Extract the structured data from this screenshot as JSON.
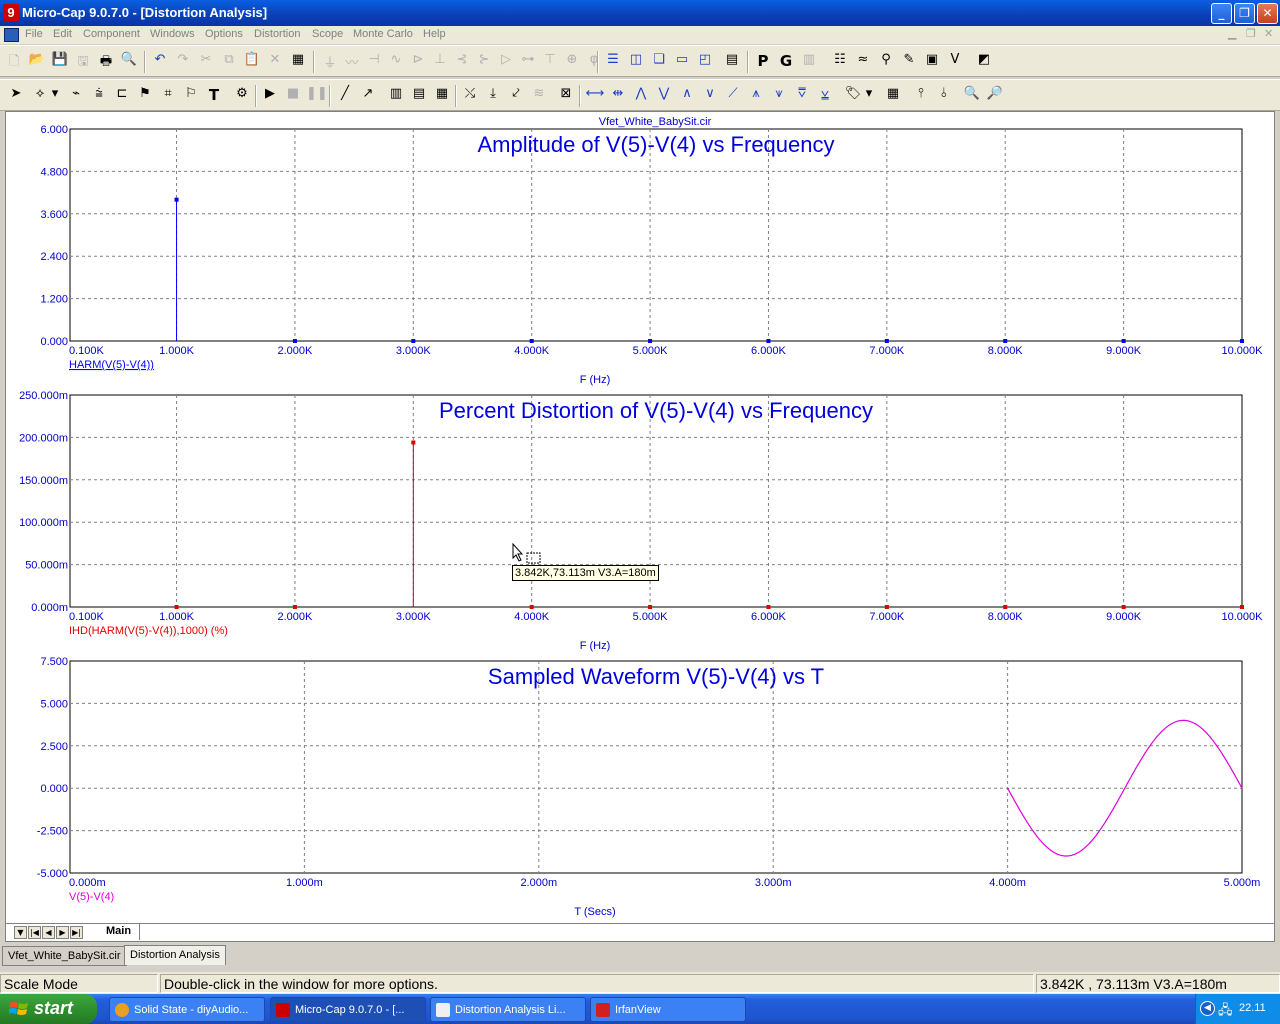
{
  "window": {
    "title": "Micro-Cap 9.0.7.0 - [Distortion Analysis]",
    "app_icon": "9"
  },
  "menu": [
    "File",
    "Edit",
    "Component",
    "Windows",
    "Options",
    "Distortion",
    "Scope",
    "Monte Carlo",
    "Help"
  ],
  "plot": {
    "circuit_name": "Vfet_White_BabySit.cir",
    "panels": [
      {
        "title": "Amplitude of V(5)-V(4) vs Frequency",
        "y_ticks": [
          "6.000",
          "4.800",
          "3.600",
          "2.400",
          "1.200",
          "0.000"
        ],
        "x_ticks": [
          "0.100K",
          "1.000K",
          "2.000K",
          "3.000K",
          "4.000K",
          "5.000K",
          "6.000K",
          "7.000K",
          "8.000K",
          "9.000K",
          "10.000K"
        ],
        "trace_label": "HARM(V(5)-V(4))",
        "xlabel": "F (Hz)",
        "color": "#0000ff"
      },
      {
        "title": "Percent Distortion of V(5)-V(4) vs Frequency",
        "y_ticks": [
          "250.000m",
          "200.000m",
          "150.000m",
          "100.000m",
          "50.000m",
          "0.000m"
        ],
        "x_ticks": [
          "0.100K",
          "1.000K",
          "2.000K",
          "3.000K",
          "4.000K",
          "5.000K",
          "6.000K",
          "7.000K",
          "8.000K",
          "9.000K",
          "10.000K"
        ],
        "trace_label": "IHD(HARM(V(5)-V(4)),1000) (%)",
        "xlabel": "F (Hz)",
        "color": "#e00000"
      },
      {
        "title": "Sampled Waveform  V(5)-V(4) vs T",
        "y_ticks": [
          "7.500",
          "5.000",
          "2.500",
          "0.000",
          "-2.500",
          "-5.000"
        ],
        "x_ticks": [
          "0.000m",
          "1.000m",
          "2.000m",
          "3.000m",
          "4.000m",
          "5.000m"
        ],
        "trace_label": "V(5)-V(4)",
        "xlabel": "T (Secs)",
        "color": "#e000e0"
      }
    ],
    "tooltip": "3.842K,73.113m V3.A=180m"
  },
  "chart_data": [
    {
      "type": "bar",
      "title": "Amplitude of V(5)-V(4) vs Frequency",
      "xlabel": "F (Hz)",
      "ylabel": "",
      "xlim": [
        100,
        10000
      ],
      "ylim": [
        0,
        6
      ],
      "x": [
        1000,
        2000,
        3000,
        4000,
        5000,
        6000,
        7000,
        8000,
        9000,
        10000
      ],
      "series": [
        {
          "name": "HARM(V(5)-V(4))",
          "values": [
            4.0,
            0.0,
            0.0,
            0.0,
            0.0,
            0.0,
            0.0,
            0.0,
            0.0,
            0.0
          ]
        }
      ],
      "grid": true
    },
    {
      "type": "bar",
      "title": "Percent Distortion of V(5)-V(4) vs Frequency",
      "xlabel": "F (Hz)",
      "ylabel": "",
      "xlim": [
        100,
        10000
      ],
      "ylim": [
        0,
        250
      ],
      "y_unit": "m",
      "x": [
        1000,
        2000,
        3000,
        4000,
        5000,
        6000,
        7000,
        8000,
        9000,
        10000
      ],
      "series": [
        {
          "name": "IHD(HARM(V(5)-V(4)),1000) (%)",
          "values": [
            0.0,
            0.0,
            194.0,
            0.0,
            0.0,
            0.0,
            0.0,
            0.0,
            0.0,
            0.0
          ]
        }
      ],
      "grid": true
    },
    {
      "type": "line",
      "title": "Sampled Waveform  V(5)-V(4) vs T",
      "xlabel": "T (Secs)",
      "ylabel": "",
      "xlim": [
        0,
        5
      ],
      "x_unit": "m",
      "ylim": [
        -5,
        7.5
      ],
      "series": [
        {
          "name": "V(5)-V(4)",
          "t_start": 4.0,
          "t_end": 5.0,
          "amplitude": 4.0,
          "frequency_hz": 1000,
          "phase": "inverted sine"
        }
      ],
      "grid": true
    }
  ],
  "main_tab": "Main",
  "doc_tabs": [
    "Vfet_White_BabySit.cir",
    "Distortion Analysis"
  ],
  "status": {
    "mode": "Scale Mode",
    "message": "Double-click in the window for more options.",
    "readout": "3.842K , 73.113m  V3.A=180m"
  },
  "taskbar": {
    "start": "start",
    "tasks": [
      {
        "label": "Solid State - diyAudio...",
        "icon_color": "#e8a020"
      },
      {
        "label": "Micro-Cap 9.0.7.0 - [...",
        "icon_color": "#cc0000"
      },
      {
        "label": "Distortion Analysis Li...",
        "icon_color": "#f0f0f0"
      },
      {
        "label": "IrfanView",
        "icon_color": "#d02020"
      }
    ],
    "clock": "22.11"
  }
}
